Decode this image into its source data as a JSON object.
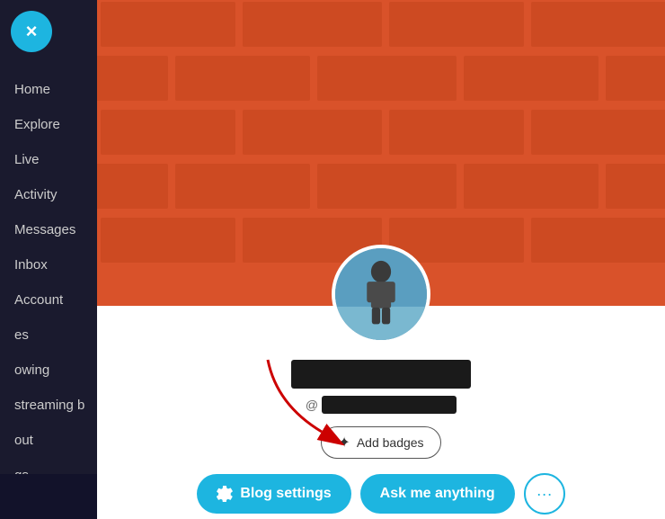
{
  "sidebar": {
    "close_label": "×",
    "nav_items": [
      {
        "label": "Home",
        "id": "home"
      },
      {
        "label": "Explore",
        "id": "explore"
      },
      {
        "label": "Live",
        "id": "live"
      },
      {
        "label": "Activity",
        "id": "activity"
      },
      {
        "label": "Messages",
        "id": "messages"
      },
      {
        "label": "Inbox",
        "id": "inbox"
      },
      {
        "label": "Account",
        "id": "account"
      },
      {
        "label": "es",
        "id": "es"
      },
      {
        "label": "owing",
        "id": "owing"
      },
      {
        "label": "streaming b",
        "id": "streaming"
      },
      {
        "label": "out",
        "id": "out"
      },
      {
        "label": "gs",
        "id": "gs"
      }
    ]
  },
  "profile": {
    "add_badges_label": "Add badges",
    "blog_settings_label": "Blog settings",
    "ask_me_anything_label": "Ask me anything",
    "more_dots": "···"
  },
  "colors": {
    "sidebar_bg": "#1a1a2e",
    "close_btn": "#1db5e0",
    "banner_bg": "#d9522a",
    "btn_primary": "#1db5e0"
  }
}
